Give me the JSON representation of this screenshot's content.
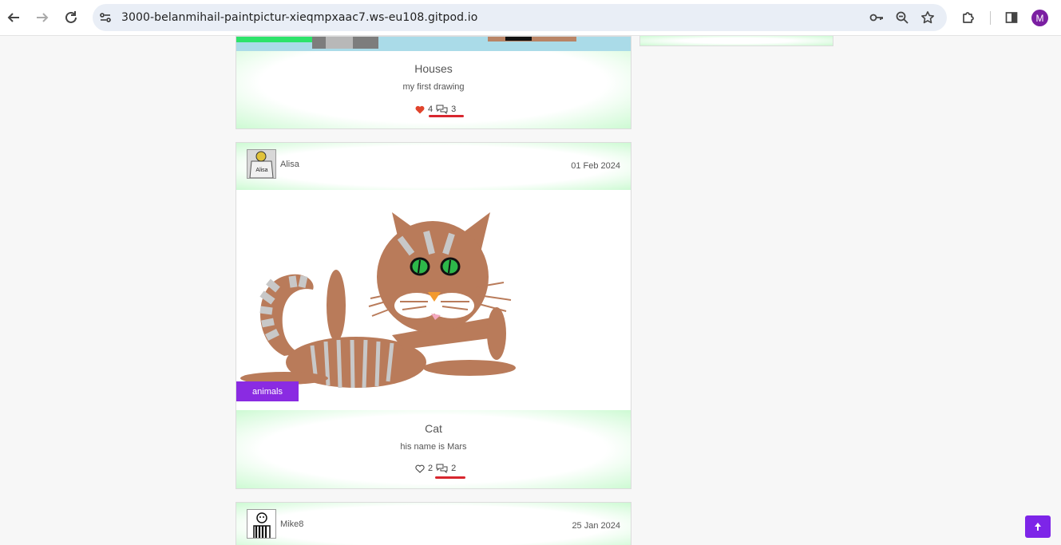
{
  "browser": {
    "url": "3000-belanmihail-paintpictur-xieqmpxaac7.ws-eu108.gitpod.io",
    "profile_initial": "M",
    "profile_color": "#7b1fa2"
  },
  "posts": [
    {
      "title": "Houses",
      "description": "my first drawing",
      "likes": "4",
      "comments": "3",
      "liked": true
    },
    {
      "author": "Alisa",
      "avatar_label": "Alisa",
      "date": "01 Feb 2024",
      "tag": "animals",
      "title": "Cat",
      "description": "his name is Mars",
      "likes": "2",
      "comments": "2",
      "liked": false
    },
    {
      "author": "Mike8",
      "date": "25 Jan 2024"
    }
  ],
  "colors": {
    "accent_purple": "#8a2be2",
    "like_red": "#e0442c",
    "underline_red": "#d8262e",
    "glow_green": "#cdfad3"
  },
  "icons": {
    "back": "arrow-left-icon",
    "forward": "arrow-right-icon",
    "reload": "reload-icon",
    "site_info": "tune-icon",
    "password": "key-icon",
    "zoom": "zoom-icon",
    "bookmark": "star-icon",
    "extensions": "puzzle-icon",
    "side_panel": "side-panel-icon",
    "scroll_top": "arrow-up-icon"
  }
}
